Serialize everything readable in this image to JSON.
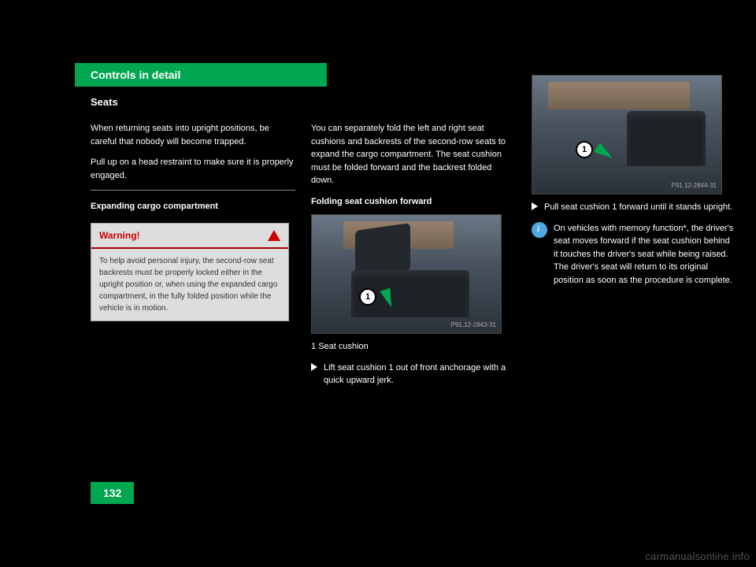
{
  "header": {
    "title": "Controls in detail"
  },
  "section_label": "Seats",
  "page_number": "132",
  "watermark": "carmanualsonline.info",
  "col1": {
    "p1": "When returning seats into upright positions, be careful that nobody will become trapped.",
    "p2": "Pull up on a head restraint to make sure it is properly engaged.",
    "subhead": "Expanding cargo compartment",
    "warning_title": "Warning!",
    "warning_body": "To help avoid personal injury, the second-row seat backrests must be properly locked either in the upright position or, when using the expanded cargo compartment, in the fully folded position while the vehicle is in motion."
  },
  "col2": {
    "intro": "You can separately fold the left and right seat cushions and backrests of the second-row seats to expand the cargo compartment. The seat cushion must be folded forward and the backrest folded down.",
    "subhead": "Folding seat cushion forward",
    "photo_id": "P91.12-2843-31",
    "callout1_label": "1",
    "callout1_text": "Seat cushion",
    "step": "Lift seat cushion 1 out of front anchorage with a quick upward jerk."
  },
  "col3": {
    "photo_id": "P91.12-2844-31",
    "callout1_label": "1",
    "step": "Pull seat cushion 1 forward until it stands upright.",
    "note": "On vehicles with memory function*, the driver's seat moves forward if the seat cushion behind it touches the driver's seat while being raised. The driver's seat will return to its original position as soon as the procedure is complete."
  }
}
